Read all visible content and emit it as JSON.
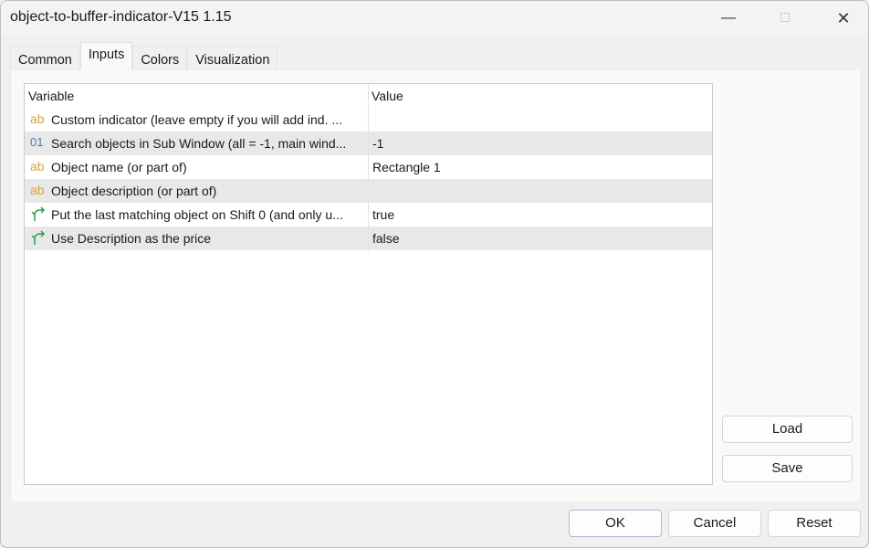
{
  "window": {
    "title": "object-to-buffer-indicator-V15 1.15",
    "controls": {
      "minimize_icon": "minimize-icon",
      "maximize_icon": "maximize-icon",
      "close_icon": "close-icon"
    }
  },
  "tabs": [
    {
      "label": "Common",
      "active": false
    },
    {
      "label": "Inputs",
      "active": true
    },
    {
      "label": "Colors",
      "active": false
    },
    {
      "label": "Visualization",
      "active": false
    }
  ],
  "grid": {
    "columns": [
      "Variable",
      "Value"
    ],
    "rows": [
      {
        "type": "string",
        "icon": "ab",
        "variable": "Custom indicator (leave empty if you will add ind. ...",
        "value": ""
      },
      {
        "type": "integer",
        "icon": "01",
        "variable": "Search objects in Sub Window (all = -1, main wind...",
        "value": "-1"
      },
      {
        "type": "string",
        "icon": "ab",
        "variable": "Object name (or part of)",
        "value": "Rectangle 1"
      },
      {
        "type": "string",
        "icon": "ab",
        "variable": "Object description (or part of)",
        "value": ""
      },
      {
        "type": "bool",
        "icon": "↱",
        "variable": "Put the last matching object on Shift 0 (and only u...",
        "value": "true"
      },
      {
        "type": "bool",
        "icon": "↱",
        "variable": "Use Description as the price",
        "value": "false"
      }
    ]
  },
  "side_buttons": {
    "load": "Load",
    "save": "Save"
  },
  "bottom_buttons": {
    "ok": "OK",
    "cancel": "Cancel",
    "reset": "Reset"
  }
}
